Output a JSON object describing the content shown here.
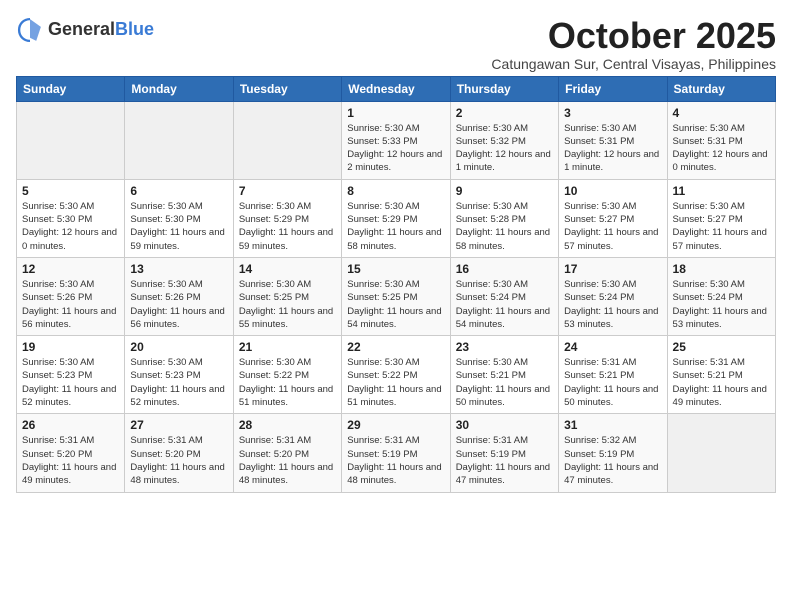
{
  "header": {
    "logo_general": "General",
    "logo_blue": "Blue",
    "month_title": "October 2025",
    "subtitle": "Catungawan Sur, Central Visayas, Philippines"
  },
  "columns": [
    "Sunday",
    "Monday",
    "Tuesday",
    "Wednesday",
    "Thursday",
    "Friday",
    "Saturday"
  ],
  "weeks": [
    [
      {
        "day": "",
        "info": ""
      },
      {
        "day": "",
        "info": ""
      },
      {
        "day": "",
        "info": ""
      },
      {
        "day": "1",
        "info": "Sunrise: 5:30 AM\nSunset: 5:33 PM\nDaylight: 12 hours and 2 minutes."
      },
      {
        "day": "2",
        "info": "Sunrise: 5:30 AM\nSunset: 5:32 PM\nDaylight: 12 hours and 1 minute."
      },
      {
        "day": "3",
        "info": "Sunrise: 5:30 AM\nSunset: 5:31 PM\nDaylight: 12 hours and 1 minute."
      },
      {
        "day": "4",
        "info": "Sunrise: 5:30 AM\nSunset: 5:31 PM\nDaylight: 12 hours and 0 minutes."
      }
    ],
    [
      {
        "day": "5",
        "info": "Sunrise: 5:30 AM\nSunset: 5:30 PM\nDaylight: 12 hours and 0 minutes."
      },
      {
        "day": "6",
        "info": "Sunrise: 5:30 AM\nSunset: 5:30 PM\nDaylight: 11 hours and 59 minutes."
      },
      {
        "day": "7",
        "info": "Sunrise: 5:30 AM\nSunset: 5:29 PM\nDaylight: 11 hours and 59 minutes."
      },
      {
        "day": "8",
        "info": "Sunrise: 5:30 AM\nSunset: 5:29 PM\nDaylight: 11 hours and 58 minutes."
      },
      {
        "day": "9",
        "info": "Sunrise: 5:30 AM\nSunset: 5:28 PM\nDaylight: 11 hours and 58 minutes."
      },
      {
        "day": "10",
        "info": "Sunrise: 5:30 AM\nSunset: 5:27 PM\nDaylight: 11 hours and 57 minutes."
      },
      {
        "day": "11",
        "info": "Sunrise: 5:30 AM\nSunset: 5:27 PM\nDaylight: 11 hours and 57 minutes."
      }
    ],
    [
      {
        "day": "12",
        "info": "Sunrise: 5:30 AM\nSunset: 5:26 PM\nDaylight: 11 hours and 56 minutes."
      },
      {
        "day": "13",
        "info": "Sunrise: 5:30 AM\nSunset: 5:26 PM\nDaylight: 11 hours and 56 minutes."
      },
      {
        "day": "14",
        "info": "Sunrise: 5:30 AM\nSunset: 5:25 PM\nDaylight: 11 hours and 55 minutes."
      },
      {
        "day": "15",
        "info": "Sunrise: 5:30 AM\nSunset: 5:25 PM\nDaylight: 11 hours and 54 minutes."
      },
      {
        "day": "16",
        "info": "Sunrise: 5:30 AM\nSunset: 5:24 PM\nDaylight: 11 hours and 54 minutes."
      },
      {
        "day": "17",
        "info": "Sunrise: 5:30 AM\nSunset: 5:24 PM\nDaylight: 11 hours and 53 minutes."
      },
      {
        "day": "18",
        "info": "Sunrise: 5:30 AM\nSunset: 5:24 PM\nDaylight: 11 hours and 53 minutes."
      }
    ],
    [
      {
        "day": "19",
        "info": "Sunrise: 5:30 AM\nSunset: 5:23 PM\nDaylight: 11 hours and 52 minutes."
      },
      {
        "day": "20",
        "info": "Sunrise: 5:30 AM\nSunset: 5:23 PM\nDaylight: 11 hours and 52 minutes."
      },
      {
        "day": "21",
        "info": "Sunrise: 5:30 AM\nSunset: 5:22 PM\nDaylight: 11 hours and 51 minutes."
      },
      {
        "day": "22",
        "info": "Sunrise: 5:30 AM\nSunset: 5:22 PM\nDaylight: 11 hours and 51 minutes."
      },
      {
        "day": "23",
        "info": "Sunrise: 5:30 AM\nSunset: 5:21 PM\nDaylight: 11 hours and 50 minutes."
      },
      {
        "day": "24",
        "info": "Sunrise: 5:31 AM\nSunset: 5:21 PM\nDaylight: 11 hours and 50 minutes."
      },
      {
        "day": "25",
        "info": "Sunrise: 5:31 AM\nSunset: 5:21 PM\nDaylight: 11 hours and 49 minutes."
      }
    ],
    [
      {
        "day": "26",
        "info": "Sunrise: 5:31 AM\nSunset: 5:20 PM\nDaylight: 11 hours and 49 minutes."
      },
      {
        "day": "27",
        "info": "Sunrise: 5:31 AM\nSunset: 5:20 PM\nDaylight: 11 hours and 48 minutes."
      },
      {
        "day": "28",
        "info": "Sunrise: 5:31 AM\nSunset: 5:20 PM\nDaylight: 11 hours and 48 minutes."
      },
      {
        "day": "29",
        "info": "Sunrise: 5:31 AM\nSunset: 5:19 PM\nDaylight: 11 hours and 48 minutes."
      },
      {
        "day": "30",
        "info": "Sunrise: 5:31 AM\nSunset: 5:19 PM\nDaylight: 11 hours and 47 minutes."
      },
      {
        "day": "31",
        "info": "Sunrise: 5:32 AM\nSunset: 5:19 PM\nDaylight: 11 hours and 47 minutes."
      },
      {
        "day": "",
        "info": ""
      }
    ]
  ]
}
